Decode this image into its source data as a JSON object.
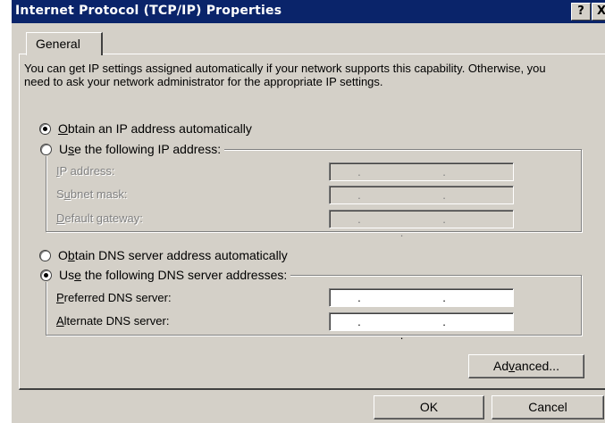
{
  "window": {
    "title": "Internet Protocol (TCP/IP) Properties",
    "help_button": "?",
    "close_button": "X"
  },
  "tabs": [
    {
      "label": "General"
    }
  ],
  "description": "You can get IP settings assigned automatically if your network supports this capability. Otherwise, you need to ask your network administrator for the appropriate IP settings.",
  "ip_options": {
    "auto": {
      "pre": "",
      "key": "O",
      "post": "btain an IP address automatically",
      "checked": true
    },
    "manual": {
      "pre": "U",
      "key": "s",
      "post": "e the following IP address:",
      "checked": false
    }
  },
  "ip_fields": [
    {
      "pre": "",
      "key": "I",
      "post": "P address:",
      "value": ". . ."
    },
    {
      "pre": "S",
      "key": "u",
      "post": "bnet mask:",
      "value": ". . ."
    },
    {
      "pre": "",
      "key": "D",
      "post": "efault gateway:",
      "value": ". . ."
    }
  ],
  "dns_options": {
    "auto": {
      "pre": "O",
      "key": "b",
      "post": "tain DNS server address automatically",
      "checked": false
    },
    "manual": {
      "pre": "Us",
      "key": "e",
      "post": " the following DNS server addresses:",
      "checked": true
    }
  },
  "dns_fields": [
    {
      "pre": "",
      "key": "P",
      "post": "referred DNS server:",
      "value": ". . ."
    },
    {
      "pre": "",
      "key": "A",
      "post": "lternate DNS server:",
      "value": ". . ."
    }
  ],
  "buttons": {
    "advanced": {
      "pre": "Ad",
      "key": "v",
      "post": "anced..."
    },
    "ok": "OK",
    "cancel": "Cancel"
  }
}
